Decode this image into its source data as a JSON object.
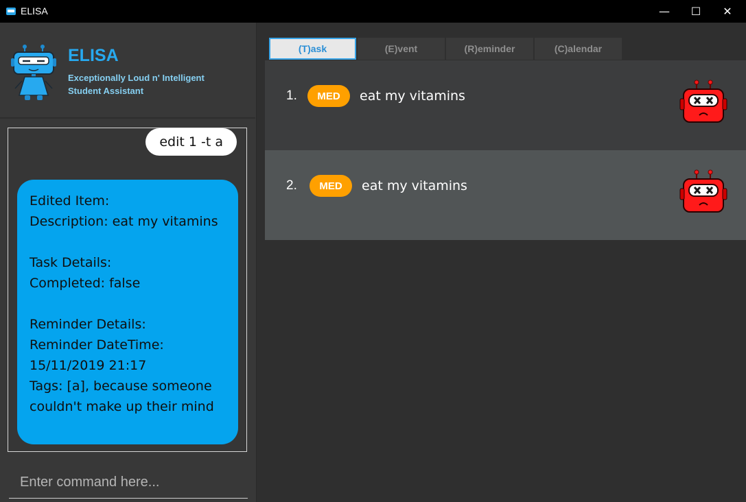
{
  "window": {
    "title": "ELISA",
    "minimize": "—",
    "maximize": "☐",
    "close": "✕"
  },
  "header": {
    "brand": "ELISA",
    "tagline_line1": "Exceptionally Loud n' Intelligent",
    "tagline_line2": "Student Assistant"
  },
  "chat": {
    "user_message": "edit 1 -t a",
    "bot_message": "Edited Item:\nDescription: eat my vitamins\n\nTask Details:\nCompleted: false\n\nReminder Details:\nReminder DateTime:\n15/11/2019 21:17\nTags: [a], because someone couldn't make up their mind"
  },
  "command": {
    "placeholder": "Enter command here..."
  },
  "tabs": [
    {
      "label": "(T)ask",
      "active": true
    },
    {
      "label": "(E)vent",
      "active": false
    },
    {
      "label": "(R)eminder",
      "active": false
    },
    {
      "label": "(C)alendar",
      "active": false
    }
  ],
  "tasks": [
    {
      "index": "1.",
      "priority": "MED",
      "description": "eat my vitamins"
    },
    {
      "index": "2.",
      "priority": "MED",
      "description": "eat my vitamins"
    }
  ],
  "colors": {
    "accent": "#27a9ef",
    "bot_bubble": "#05a4ee",
    "priority_med": "#ffa000",
    "robot_red": "#ff1a1a"
  },
  "icons": {
    "mascot": "elisa-mascot-icon",
    "status": "dead-robot-icon"
  }
}
